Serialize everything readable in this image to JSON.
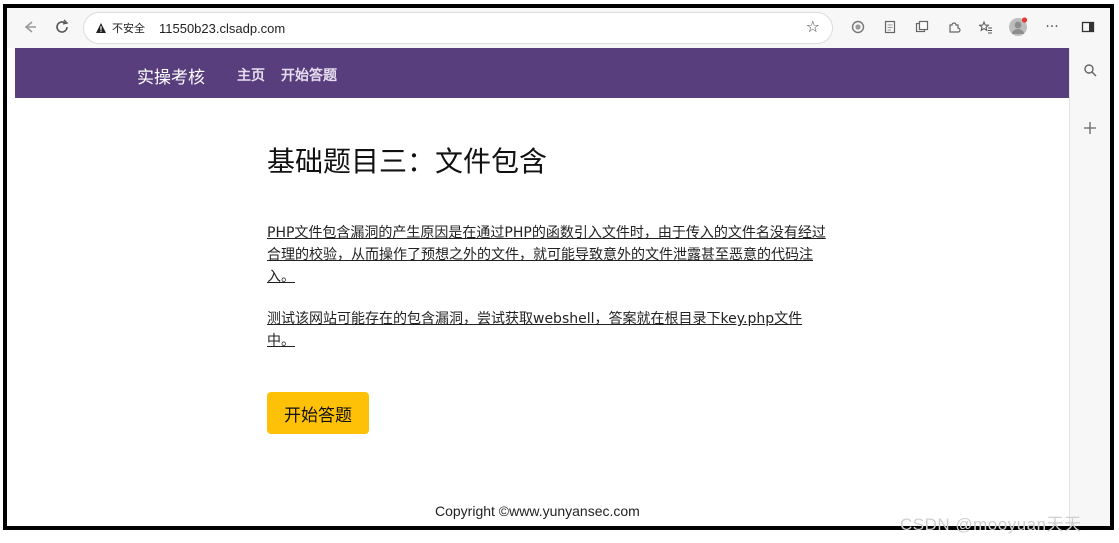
{
  "browser": {
    "security_label": "不安全",
    "url": "11550b23.clsadp.com"
  },
  "site": {
    "brand": "实操考核",
    "nav": [
      {
        "label": "主页"
      },
      {
        "label": "开始答题"
      }
    ]
  },
  "content": {
    "title": "基础题目三：文件包含",
    "paragraph1": "PHP文件包含漏洞的产生原因是在通过PHP的函数引入文件时，由于传入的文件名没有经过合理的校验，从而操作了预想之外的文件，就可能导致意外的文件泄露甚至恶意的代码注入。",
    "paragraph2": "测试该网站可能存在的包含漏洞，尝试获取webshell，答案就在根目录下key.php文件中。",
    "start_button": "开始答题"
  },
  "footer": {
    "copyright": "Copyright ©www.yunyansec.com"
  },
  "watermark": "CSDN @mooyuan天天",
  "colors": {
    "nav_bg": "#583e7c",
    "button_bg": "#ffc107"
  },
  "icons": [
    "back-arrow-icon",
    "reload-icon",
    "warning-icon",
    "star-icon",
    "extensions-icon",
    "reading-icon",
    "collections-icon",
    "puzzle-icon",
    "favorites-icon",
    "profile-icon",
    "more-icon",
    "sidebar-icon",
    "search-icon",
    "add-icon"
  ]
}
